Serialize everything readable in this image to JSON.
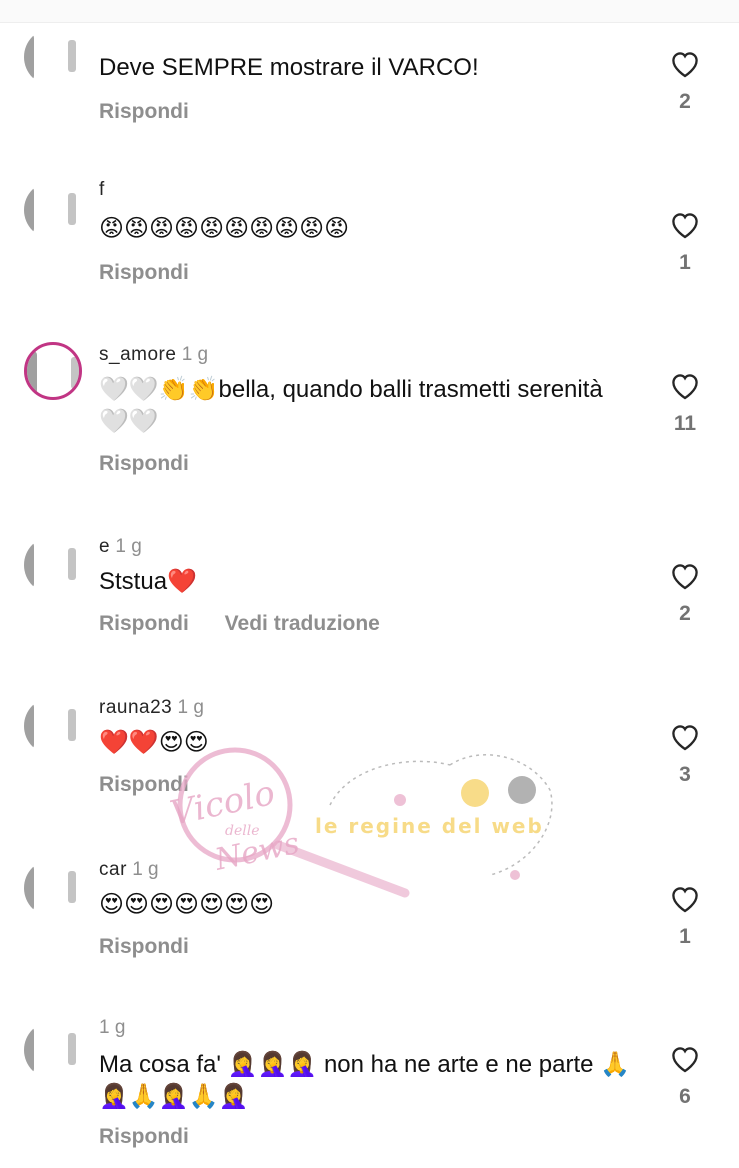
{
  "comments": [
    {
      "user": "",
      "time": "",
      "text": "Deve SEMPRE mostrare il VARCO!",
      "reply": "Rispondi",
      "translate": "",
      "likes": "2"
    },
    {
      "user": "f",
      "time": "",
      "text": "😡😡😡😡😡😡😡😡😡😡",
      "reply": "Rispondi",
      "translate": "",
      "likes": "1"
    },
    {
      "user": "s_amore",
      "time": "1 g",
      "text": "🤍🤍👏👏bella, quando balli trasmetti serenità 🤍🤍",
      "reply": "Rispondi",
      "translate": "",
      "likes": "11"
    },
    {
      "user": "e",
      "time": "1 g",
      "text": "Ststua❤️",
      "reply": "Rispondi",
      "translate": "Vedi traduzione",
      "likes": "2"
    },
    {
      "user": "rauna23",
      "time": "1 g",
      "text": "❤️❤️😍😍",
      "reply": "Rispondi",
      "translate": "",
      "likes": "3"
    },
    {
      "user": "car",
      "time": "1 g",
      "text": "😍😍😍😍😍😍😍",
      "reply": "Rispondi",
      "translate": "",
      "likes": "1"
    },
    {
      "user": "",
      "time": "1 g",
      "text": "Ma cosa fa' 🤦‍♀️🤦‍♀️🤦‍♀️ non ha ne arte e ne parte 🙏🤦‍♀️🙏🤦‍♀️🙏🤦‍♀️",
      "reply": "Rispondi",
      "translate": "",
      "likes": "6"
    }
  ],
  "watermark": {
    "text1": "Vicolo",
    "text2": "delle",
    "text3": "News",
    "text4": "le regine del web"
  },
  "colors": {
    "heart_stroke": "#262626",
    "secondary_text": "#8e8e8e",
    "story_ring": "#c13584",
    "watermark_pink": "#e7a6c5",
    "watermark_yellow": "#f6d36b"
  }
}
